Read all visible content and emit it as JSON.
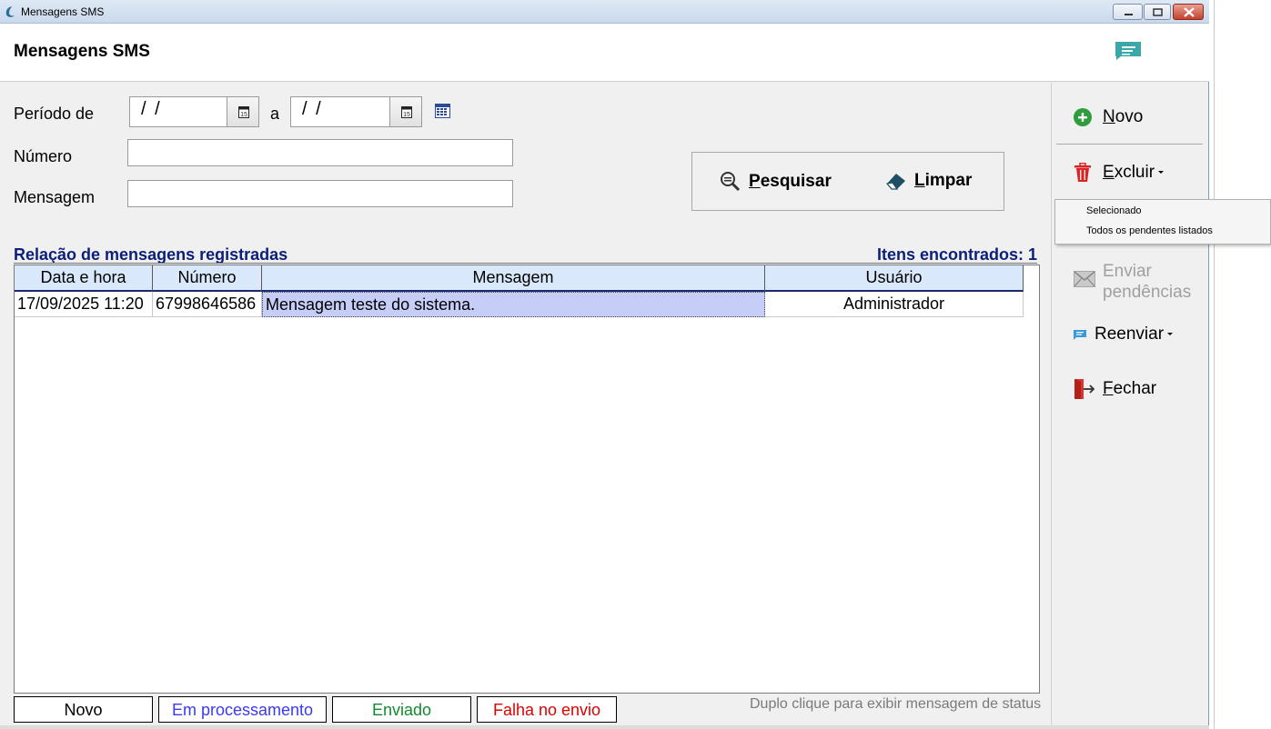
{
  "window": {
    "title": "Mensagens SMS"
  },
  "header": {
    "title": "Mensagens SMS"
  },
  "filters": {
    "periodo_label": "Período de",
    "date_from": "/ /",
    "between_label": "a",
    "date_to": "/ /",
    "numero_label": "Número",
    "numero_value": "",
    "mensagem_label": "Mensagem",
    "mensagem_value": ""
  },
  "actions": {
    "pesquisar_first": "P",
    "pesquisar_rest": "esquisar",
    "limpar_first": "L",
    "limpar_rest": "impar"
  },
  "list": {
    "title": "Relação de mensagens registradas",
    "count_label": "Itens encontrados: 1",
    "columns": [
      "Data e hora",
      "Número",
      "Mensagem",
      "Usuário"
    ],
    "rows": [
      {
        "data_hora": "17/09/2025 11:20",
        "numero": "67998646586",
        "mensagem": "Mensagem teste do sistema.",
        "usuario": "Administrador"
      }
    ]
  },
  "legend": {
    "novo": "Novo",
    "em_processamento": "Em processamento",
    "enviado": "Enviado",
    "falha": "Falha no envio",
    "colors": {
      "novo": "#000000",
      "em_processamento": "#3a3af0",
      "enviado": "#118a2e",
      "falha": "#e00000"
    }
  },
  "hint": "Duplo clique para exibir mensagem de status",
  "sidebar": {
    "novo_first": "N",
    "novo_rest": "ovo",
    "excluir_first": "E",
    "excluir_rest": "xcluir",
    "enviar_line1": "Enviar",
    "enviar_line2": "pendências",
    "reenviar": "Reenviar",
    "fechar_first": "F",
    "fechar_rest": "echar"
  },
  "excluir_menu": {
    "items": [
      "Selecionado",
      "Todos os pendentes listados"
    ]
  },
  "icons": {
    "app": "app-logo-icon",
    "header": "sms-message-icon",
    "calendar": "calendar-icon",
    "search": "magnifier-icon",
    "clear": "eraser-icon",
    "new": "plus-circle-icon",
    "delete": "trash-icon",
    "send": "envelope-icon",
    "resend": "message-icon",
    "close": "exit-door-icon"
  }
}
